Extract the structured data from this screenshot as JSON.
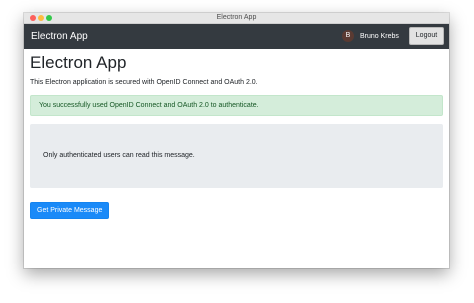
{
  "window": {
    "title": "Electron App"
  },
  "navbar": {
    "brand": "Electron App",
    "user": {
      "avatar_initial": "B",
      "name": "Bruno Krebs"
    },
    "logout_label": "Logout"
  },
  "main": {
    "heading": "Electron App",
    "subtitle": "This Electron application is secured with OpenID Connect and OAuth 2.0.",
    "alert_text": "You successfully used OpenID Connect and OAuth 2.0 to authenticate.",
    "jumbotron_text": "Only authenticated users can read this message.",
    "button_label": "Get Private Message"
  },
  "colors": {
    "navbar": "#343a40",
    "alert_bg": "#d4edda",
    "alert_text": "#155724",
    "jumbotron_bg": "#e9ecef",
    "primary": "#1a8af8"
  }
}
